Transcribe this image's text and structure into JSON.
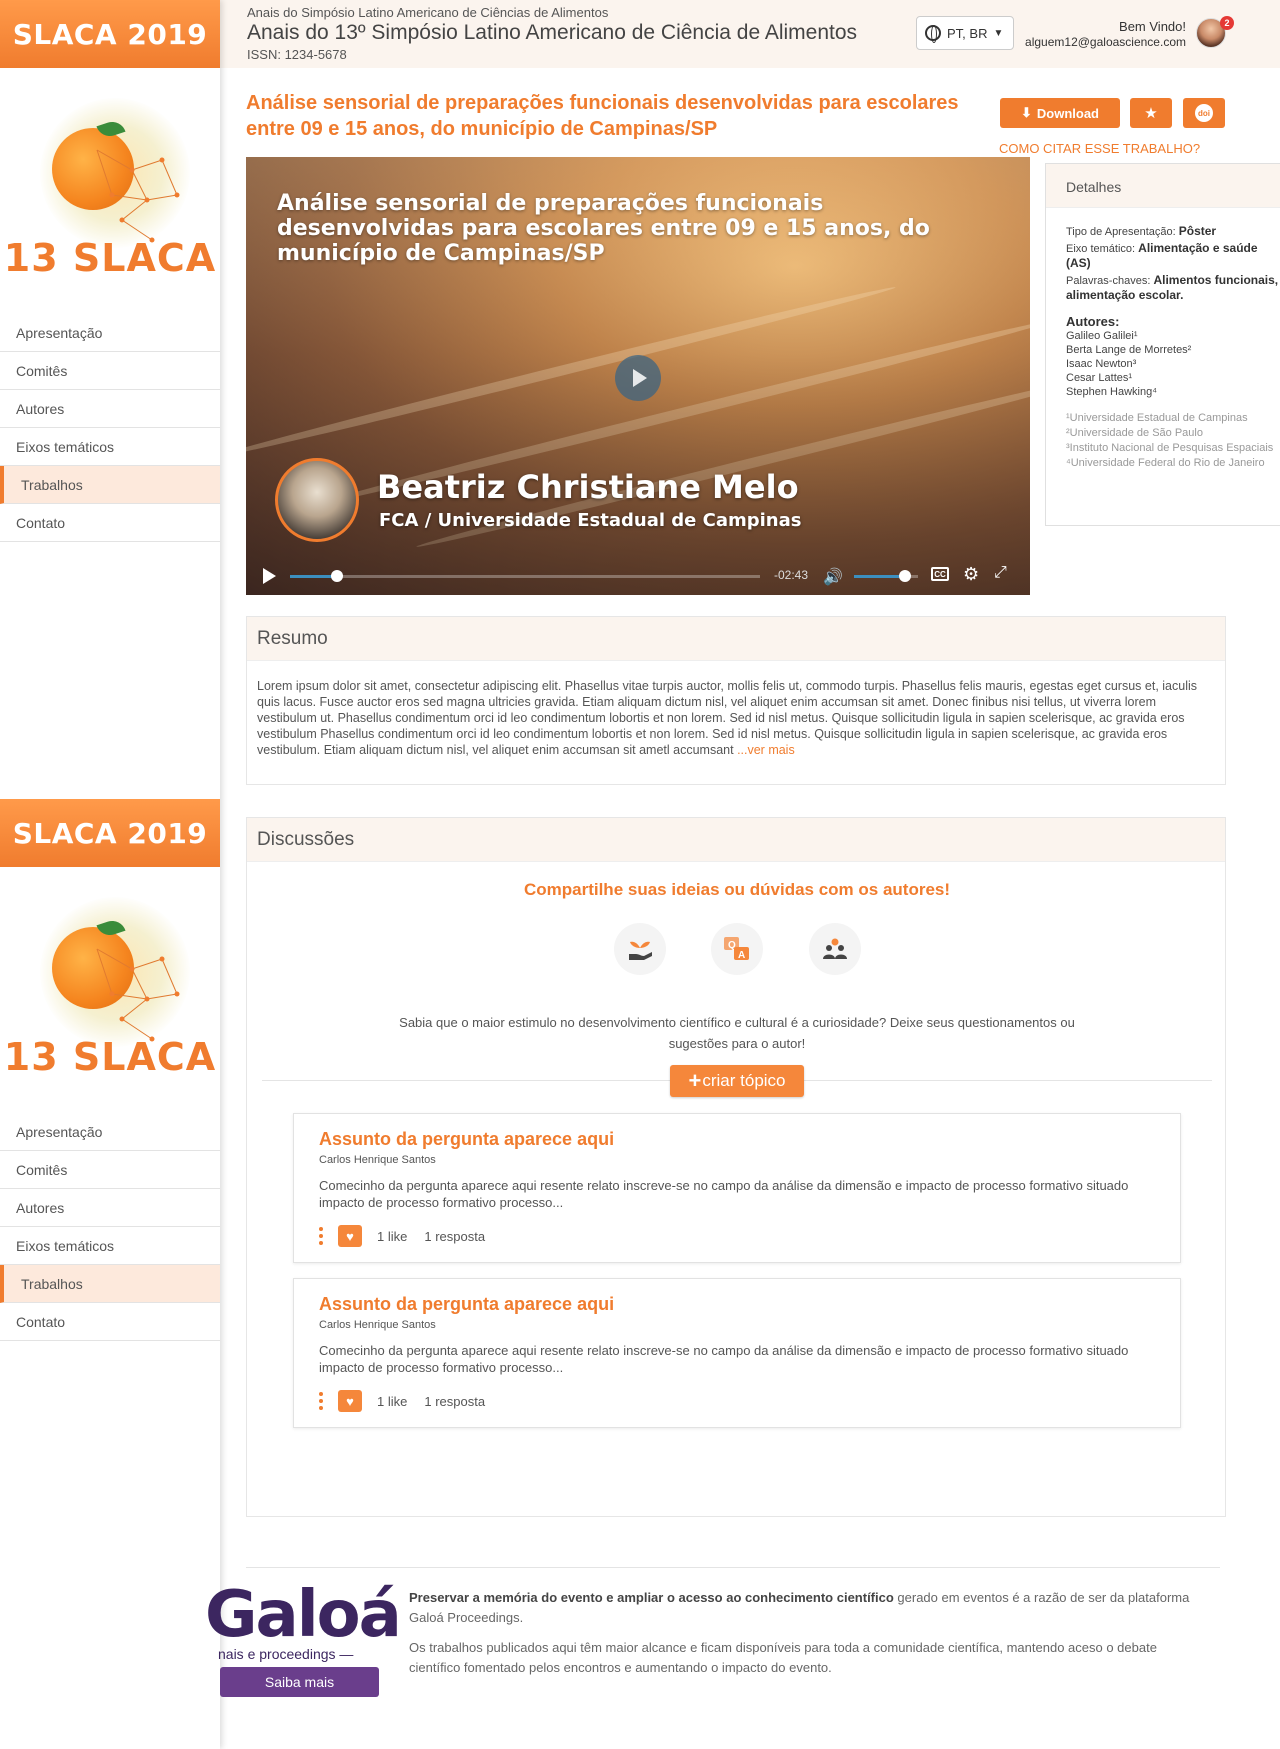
{
  "sidebar": {
    "brand": "SLACA 2019",
    "logo_text": "13 SLACA",
    "nav": [
      {
        "label": "Apresentação",
        "active": false
      },
      {
        "label": "Comitês",
        "active": false
      },
      {
        "label": "Autores",
        "active": false
      },
      {
        "label": "Eixos temáticos",
        "active": false
      },
      {
        "label": "Trabalhos",
        "active": true
      },
      {
        "label": "Contato",
        "active": false
      }
    ]
  },
  "header": {
    "subtitle": "Anais do Simpósio Latino Americano de Ciências de Alimentos",
    "title": "Anais do 13º Simpósio Latino Americano de Ciência de Alimentos",
    "issn": "ISSN: 1234-5678",
    "language": "PT, BR",
    "welcome": "Bem Vindo!",
    "email": "alguem12@galoascience.com",
    "notification_count": "2"
  },
  "paper": {
    "title": "Análise sensorial de preparações funcionais desenvolvidas para escolares entre 09 e 15 anos, do município de Campinas/SP",
    "download_label": "Download",
    "doi_label": "doi",
    "cite_label": "COMO CITAR ESSE TRABALHO?"
  },
  "video": {
    "title": "Análise sensorial de preparações funcionais desenvolvidas para escolares entre 09 e 15 anos, do município de Campinas/SP",
    "speaker_name": "Beatriz Christiane Melo",
    "speaker_affiliation": "FCA / Universidade Estadual de Campinas",
    "time_remaining": "-02:43",
    "progress_fraction": 0.1,
    "volume_fraction": 0.8,
    "cc_label": "CC"
  },
  "details": {
    "heading": "Detalhes",
    "presentation_label": "Tipo de Apresentação:",
    "presentation_value": "Pôster",
    "axis_label": "Eixo temático:",
    "axis_value": "Alimentação e saúde (AS)",
    "keywords_label": "Palavras-chaves:",
    "keywords_value": "Alimentos funcionais, alimentação escolar.",
    "authors_heading": "Autores:",
    "authors": [
      "Galileo Galilei¹",
      "Berta Lange de Morretes²",
      "Isaac Newton³",
      "Cesar Lattes¹",
      "Stephen Hawking⁴"
    ],
    "affiliations": [
      "¹Universidade Estadual de Campinas",
      "²Universidade de São Paulo",
      "³Instituto Nacional de Pesquisas Espaciais",
      "⁴Universidade Federal do Rio de Janeiro"
    ]
  },
  "resumo": {
    "heading": "Resumo",
    "text": "Lorem ipsum dolor sit amet, consectetur adipiscing elit. Phasellus vitae turpis auctor, mollis felis ut, commodo turpis. Phasellus felis mauris, egestas eget cursus et, iaculis quis lacus. Fusce auctor eros sed magna ultricies gravida. Etiam aliquam dictum nisl, vel aliquet enim accumsan sit amet. Donec finibus nisi tellus, ut viverra lorem vestibulum ut. Phasellus condimentum orci id leo condimentum lobortis et non lorem. Sed id nisl metus. Quisque sollicitudin ligula in sapien scelerisque, ac gravida eros vestibulum Phasellus condimentum orci id leo condimentum lobortis et non lorem. Sed id nisl metus. Quisque sollicitudin ligula in sapien scelerisque, ac gravida eros vestibulum. Etiam aliquam dictum nisl, vel aliquet enim accumsan sit ametl accumsant ",
    "more": "...ver mais"
  },
  "discussions": {
    "heading": "Discussões",
    "share": "Compartilhe suas ideias ou dúvidas com os autores!",
    "icons": [
      "plant-hand-icon",
      "qa-icon",
      "people-icon"
    ],
    "prompt": "Sabia que o maior estimulo no desenvolvimento científico e cultural é a curiosidade? Deixe seus questionamentos ou sugestões para o autor!",
    "create_plus": "+",
    "create_label": "criar tópico",
    "topics": [
      {
        "title": "Assunto da pergunta aparece aqui",
        "author": "Carlos Henrique Santos",
        "text": "Comecinho da pergunta aparece aqui resente relato inscreve-se no campo da análise da dimensão e impacto de processo formativo situado impacto de processo formativo processo...",
        "likes": "1 like",
        "replies": "1 resposta"
      },
      {
        "title": "Assunto da pergunta aparece aqui",
        "author": "Carlos Henrique Santos",
        "text": "Comecinho da pergunta aparece aqui resente relato inscreve-se no campo da análise da dimensão e impacto de processo formativo situado impacto de processo formativo processo...",
        "likes": "1 like",
        "replies": "1 resposta"
      }
    ]
  },
  "footer": {
    "logo": "Galoá",
    "logo_sub": "nais e proceedings —",
    "button": "Saiba mais",
    "p1_bold": "Preservar a memória do evento e ampliar o acesso ao conhecimento científico",
    "p1_rest": " gerado em eventos é a razão de ser da plataforma Galoá Proceedings.",
    "p2": "Os trabalhos publicados aqui têm maior alcance e ficam disponíveis para toda a comunidade científica, mantendo aceso o debate científico fomentado pelos encontros e aumentando o impacto do evento."
  },
  "colors": {
    "accent": "#f07c2e",
    "header_bg": "#fbf4ee",
    "galoa_purple": "#6a3e8c"
  }
}
